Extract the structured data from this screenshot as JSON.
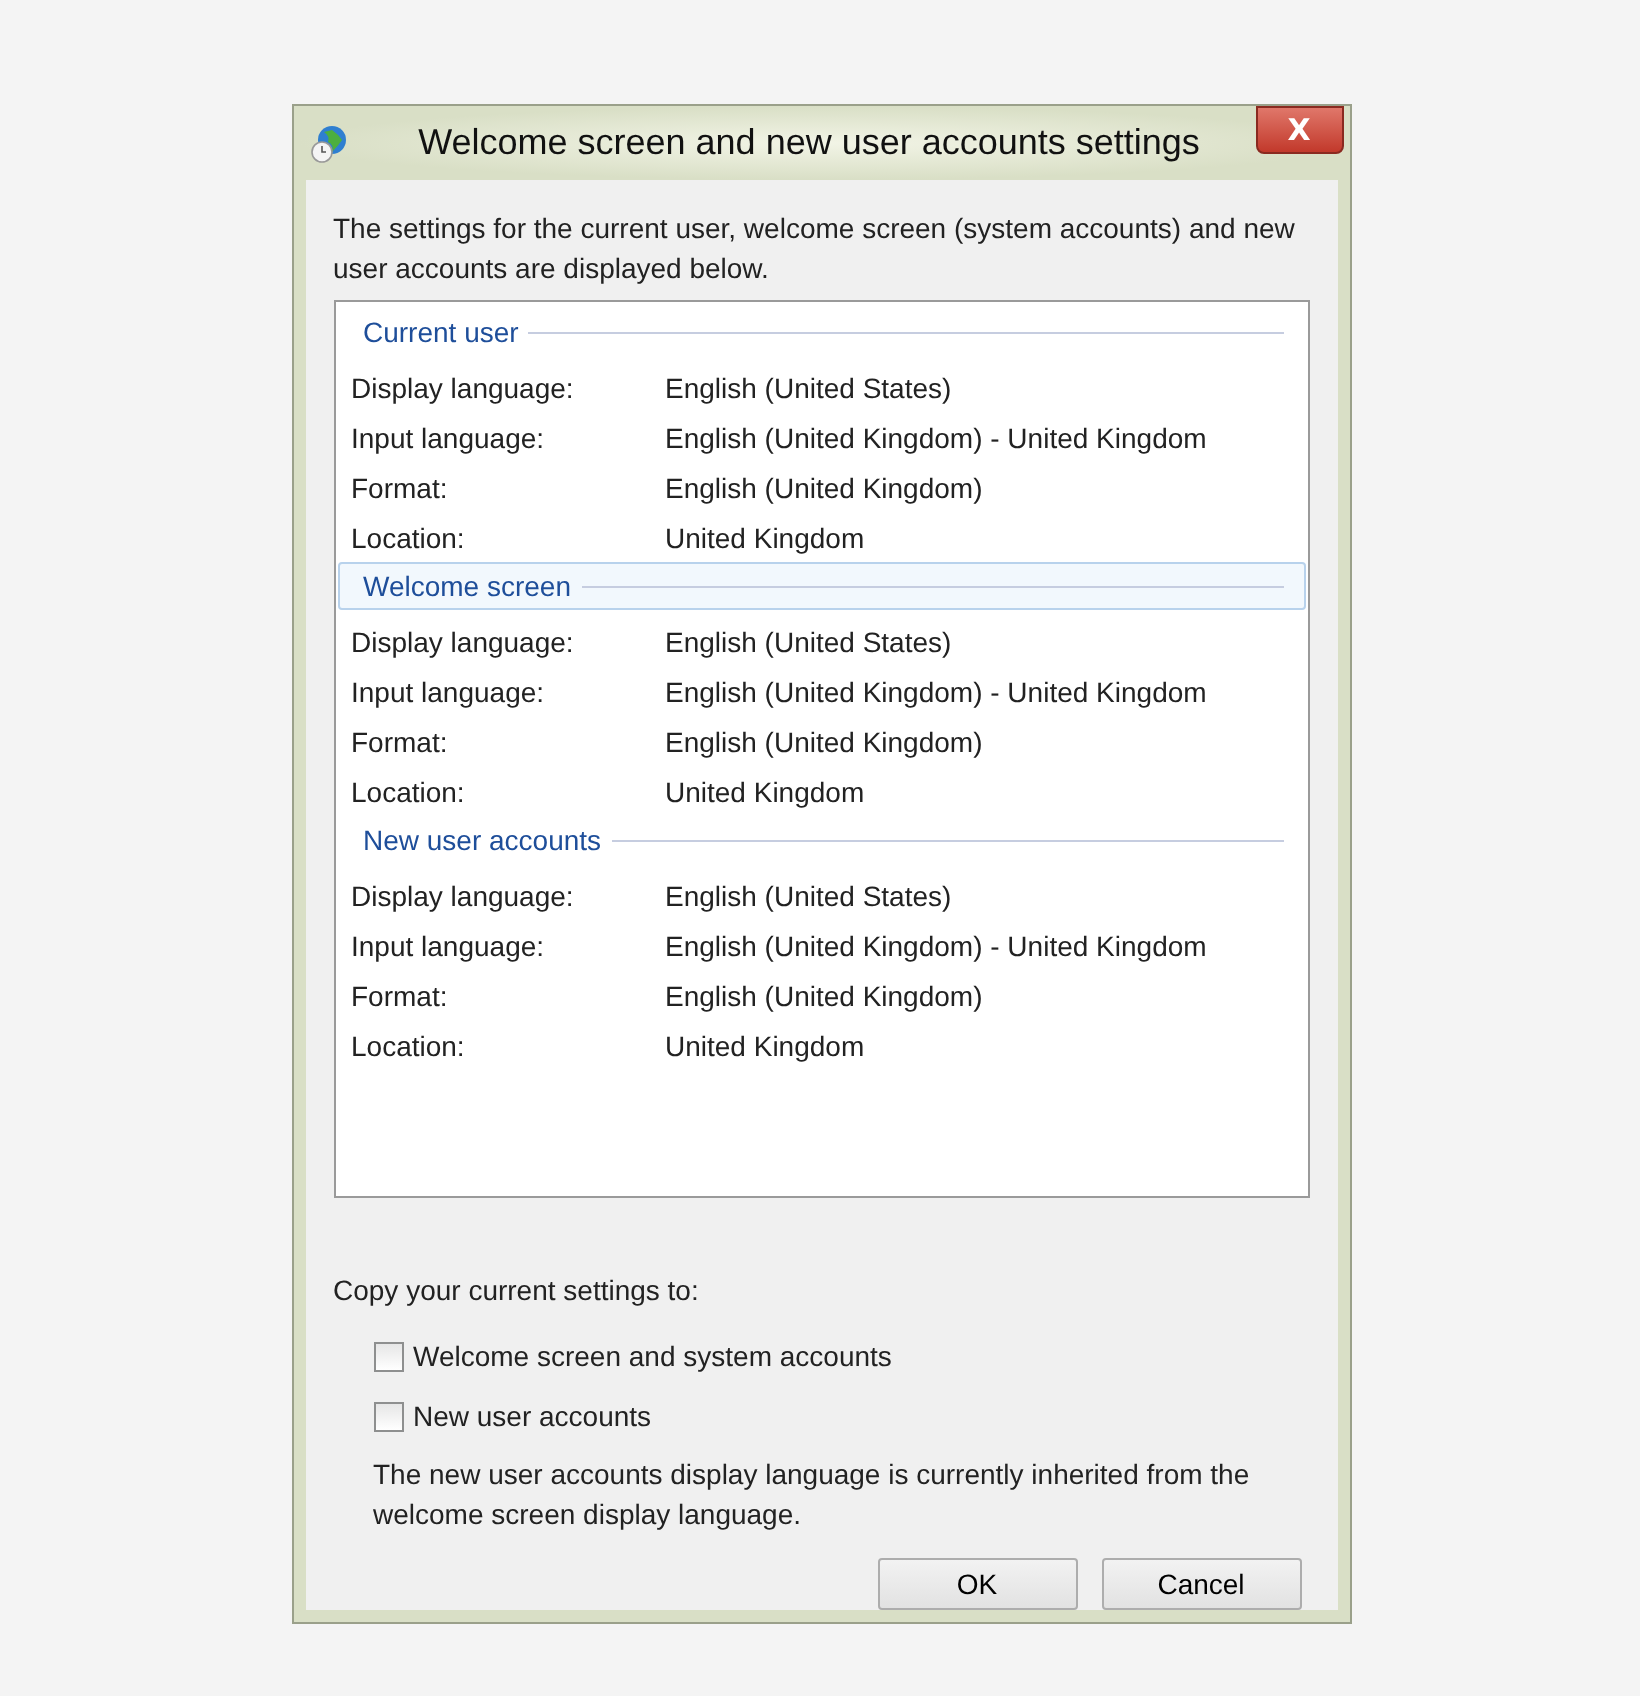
{
  "window": {
    "title": "Welcome screen and new user accounts settings",
    "close": "X"
  },
  "intro": "The settings for the current user, welcome screen (system accounts) and new user accounts are displayed below.",
  "sections": [
    {
      "title": "Current user",
      "selected": false,
      "rows": [
        {
          "label": "Display language:",
          "value": "English (United States)"
        },
        {
          "label": "Input language:",
          "value": "English (United Kingdom) - United Kingdom"
        },
        {
          "label": "Format:",
          "value": "English (United Kingdom)"
        },
        {
          "label": "Location:",
          "value": "United Kingdom"
        }
      ]
    },
    {
      "title": "Welcome screen",
      "selected": true,
      "rows": [
        {
          "label": "Display language:",
          "value": "English (United States)"
        },
        {
          "label": "Input language:",
          "value": "English (United Kingdom) - United Kingdom"
        },
        {
          "label": "Format:",
          "value": "English (United Kingdom)"
        },
        {
          "label": "Location:",
          "value": "United Kingdom"
        }
      ]
    },
    {
      "title": "New user accounts",
      "selected": false,
      "rows": [
        {
          "label": "Display language:",
          "value": "English (United States)"
        },
        {
          "label": "Input language:",
          "value": "English (United Kingdom) - United Kingdom"
        },
        {
          "label": "Format:",
          "value": "English (United Kingdom)"
        },
        {
          "label": "Location:",
          "value": "United Kingdom"
        }
      ]
    }
  ],
  "copy_label": "Copy your current settings to:",
  "options": [
    {
      "label": "Welcome screen and system accounts",
      "checked": false
    },
    {
      "label": "New user accounts",
      "checked": false
    }
  ],
  "note": "The new user accounts display language is currently inherited from the welcome screen display language.",
  "buttons": [
    "OK",
    "Cancel"
  ]
}
